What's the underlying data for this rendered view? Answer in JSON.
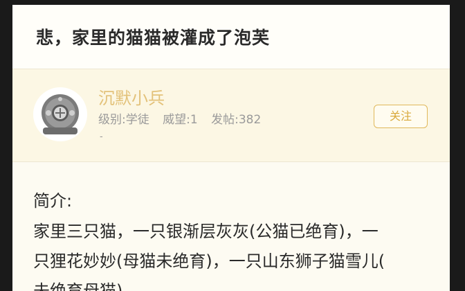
{
  "post": {
    "title": "悲，家里的猫猫被灌成了泡芙"
  },
  "author": {
    "name": "沉默小兵",
    "level": "级别:学徒",
    "reputation": "威望:1",
    "posts": "发帖:382",
    "extra": "-",
    "follow_label": "关注"
  },
  "content": {
    "intro_label": "简介:",
    "lines": [
      "家里三只猫，一只银渐层灰灰(公猫已绝育)，一",
      "只狸花妙妙(母猫未绝育)，一只山东狮子猫雪儿(",
      "未绝育母猫)。"
    ]
  },
  "colors": {
    "accent": "#e0b85a",
    "author_name": "#e3c27a",
    "card_bg": "#fcf7e4"
  }
}
